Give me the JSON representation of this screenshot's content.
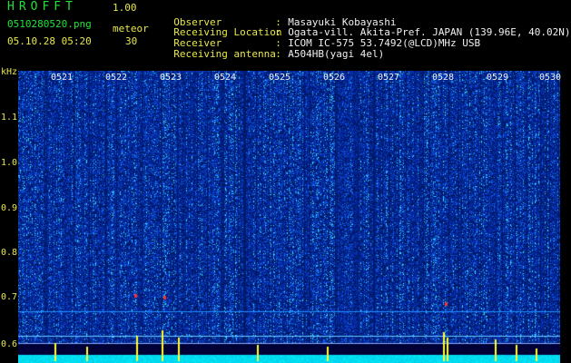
{
  "header": {
    "brand": "HROFFT",
    "version": "1.00",
    "filename": "0510280520.png",
    "detection_label": "meteor",
    "timestamp": "05.10.28 05:20",
    "detection_count": "30"
  },
  "meta": [
    {
      "label": "Observer",
      "value": "Masayuki Kobayashi"
    },
    {
      "label": "Receiving Location",
      "value": "Ogata-vill. Akita-Pref. JAPAN (139.96E, 40.02N)"
    },
    {
      "label": "Receiver",
      "value": "ICOM IC-575 53.7492(@LCD)MHz USB"
    },
    {
      "label": "Receiving antenna",
      "value": "A504HB(yagi 4el)"
    }
  ],
  "axis": {
    "unit": "kHz",
    "freq_labels": [
      "1.1",
      "1.0",
      "0.9",
      "0.8",
      "0.7",
      "0.6"
    ],
    "time_labels": [
      "0521",
      "0522",
      "0523",
      "0524",
      "0525",
      "0526",
      "0527",
      "0528",
      "0529",
      "0530"
    ]
  },
  "colors": {
    "background": "#000000",
    "header_green": "#22e23a",
    "header_yellow": "#e8e84a",
    "meta_value": "#f0f0f0",
    "noise_dark": "#001a6e",
    "noise_mid": "#0a46d2",
    "noise_bright": "#32d2ff",
    "signal": "#ffff30",
    "baseline": "#00dcff"
  }
}
